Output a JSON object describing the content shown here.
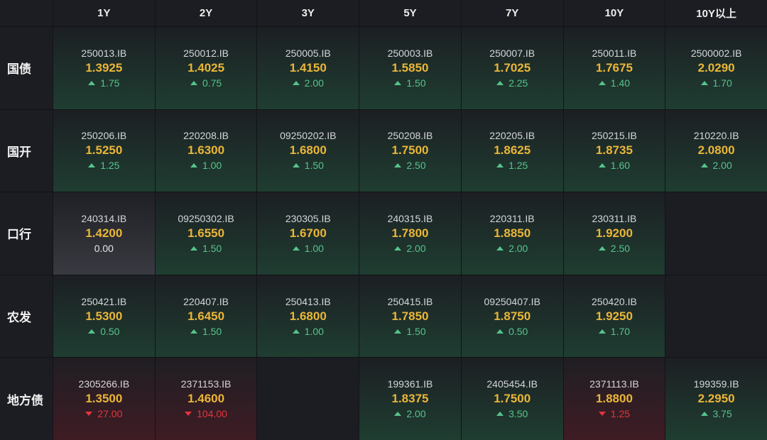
{
  "header": {
    "tenors": [
      "1Y",
      "2Y",
      "3Y",
      "5Y",
      "7Y",
      "10Y",
      "10Y以上"
    ]
  },
  "rows": [
    {
      "label": "国债",
      "cells": [
        {
          "code": "250013.IB",
          "yield": "1.3925",
          "change": "1.75",
          "trend": "up"
        },
        {
          "code": "250012.IB",
          "yield": "1.4025",
          "change": "0.75",
          "trend": "up"
        },
        {
          "code": "250005.IB",
          "yield": "1.4150",
          "change": "2.00",
          "trend": "up"
        },
        {
          "code": "250003.IB",
          "yield": "1.5850",
          "change": "1.50",
          "trend": "up"
        },
        {
          "code": "250007.IB",
          "yield": "1.7025",
          "change": "2.25",
          "trend": "up"
        },
        {
          "code": "250011.IB",
          "yield": "1.7675",
          "change": "1.40",
          "trend": "up"
        },
        {
          "code": "2500002.IB",
          "yield": "2.0290",
          "change": "1.70",
          "trend": "up"
        }
      ]
    },
    {
      "label": "国开",
      "cells": [
        {
          "code": "250206.IB",
          "yield": "1.5250",
          "change": "1.25",
          "trend": "up"
        },
        {
          "code": "220208.IB",
          "yield": "1.6300",
          "change": "1.00",
          "trend": "up"
        },
        {
          "code": "09250202.IB",
          "yield": "1.6800",
          "change": "1.50",
          "trend": "up"
        },
        {
          "code": "250208.IB",
          "yield": "1.7500",
          "change": "2.50",
          "trend": "up"
        },
        {
          "code": "220205.IB",
          "yield": "1.8625",
          "change": "1.25",
          "trend": "up"
        },
        {
          "code": "250215.IB",
          "yield": "1.8735",
          "change": "1.60",
          "trend": "up"
        },
        {
          "code": "210220.IB",
          "yield": "2.0800",
          "change": "2.00",
          "trend": "up"
        }
      ]
    },
    {
      "label": "口行",
      "cells": [
        {
          "code": "240314.IB",
          "yield": "1.4200",
          "change": "0.00",
          "trend": "flat"
        },
        {
          "code": "09250302.IB",
          "yield": "1.6550",
          "change": "1.50",
          "trend": "up"
        },
        {
          "code": "230305.IB",
          "yield": "1.6700",
          "change": "1.00",
          "trend": "up"
        },
        {
          "code": "240315.IB",
          "yield": "1.7800",
          "change": "2.00",
          "trend": "up"
        },
        {
          "code": "220311.IB",
          "yield": "1.8850",
          "change": "2.00",
          "trend": "up"
        },
        {
          "code": "230311.IB",
          "yield": "1.9200",
          "change": "2.50",
          "trend": "up"
        },
        null
      ]
    },
    {
      "label": "农发",
      "cells": [
        {
          "code": "250421.IB",
          "yield": "1.5300",
          "change": "0.50",
          "trend": "up"
        },
        {
          "code": "220407.IB",
          "yield": "1.6450",
          "change": "1.50",
          "trend": "up"
        },
        {
          "code": "250413.IB",
          "yield": "1.6800",
          "change": "1.00",
          "trend": "up"
        },
        {
          "code": "250415.IB",
          "yield": "1.7850",
          "change": "1.50",
          "trend": "up"
        },
        {
          "code": "09250407.IB",
          "yield": "1.8750",
          "change": "0.50",
          "trend": "up"
        },
        {
          "code": "250420.IB",
          "yield": "1.9250",
          "change": "1.70",
          "trend": "up"
        },
        null
      ]
    },
    {
      "label": "地方债",
      "cells": [
        {
          "code": "2305266.IB",
          "yield": "1.3500",
          "change": "27.00",
          "trend": "down"
        },
        {
          "code": "2371153.IB",
          "yield": "1.4600",
          "change": "104.00",
          "trend": "down"
        },
        null,
        {
          "code": "199361.IB",
          "yield": "1.8375",
          "change": "2.00",
          "trend": "up"
        },
        {
          "code": "2405454.IB",
          "yield": "1.7500",
          "change": "3.50",
          "trend": "up"
        },
        {
          "code": "2371113.IB",
          "yield": "1.8800",
          "change": "1.25",
          "trend": "down"
        },
        {
          "code": "199359.IB",
          "yield": "2.2950",
          "change": "3.75",
          "trend": "up"
        }
      ]
    }
  ],
  "icons": {
    "up": "up-triangle-icon",
    "down": "down-triangle-icon"
  },
  "colors": {
    "grid-line": "#121317",
    "panel-bg": "#1c1d22",
    "header-text": "#eeeeee",
    "label-text": "#f2f2f2",
    "code-text": "#d5d6da",
    "yield-text": "#eab638",
    "up": "#56c48b",
    "down": "#e5353d",
    "flat-text": "#e6e6e6",
    "up-cell-top": "#1c1f23",
    "up-cell-bottom": "#1f3d31",
    "down-cell-top": "#1f1e23",
    "down-cell-bottom": "#3f1c24",
    "flat-cell-top": "#1f2025",
    "flat-cell-bottom": "#393a41"
  }
}
